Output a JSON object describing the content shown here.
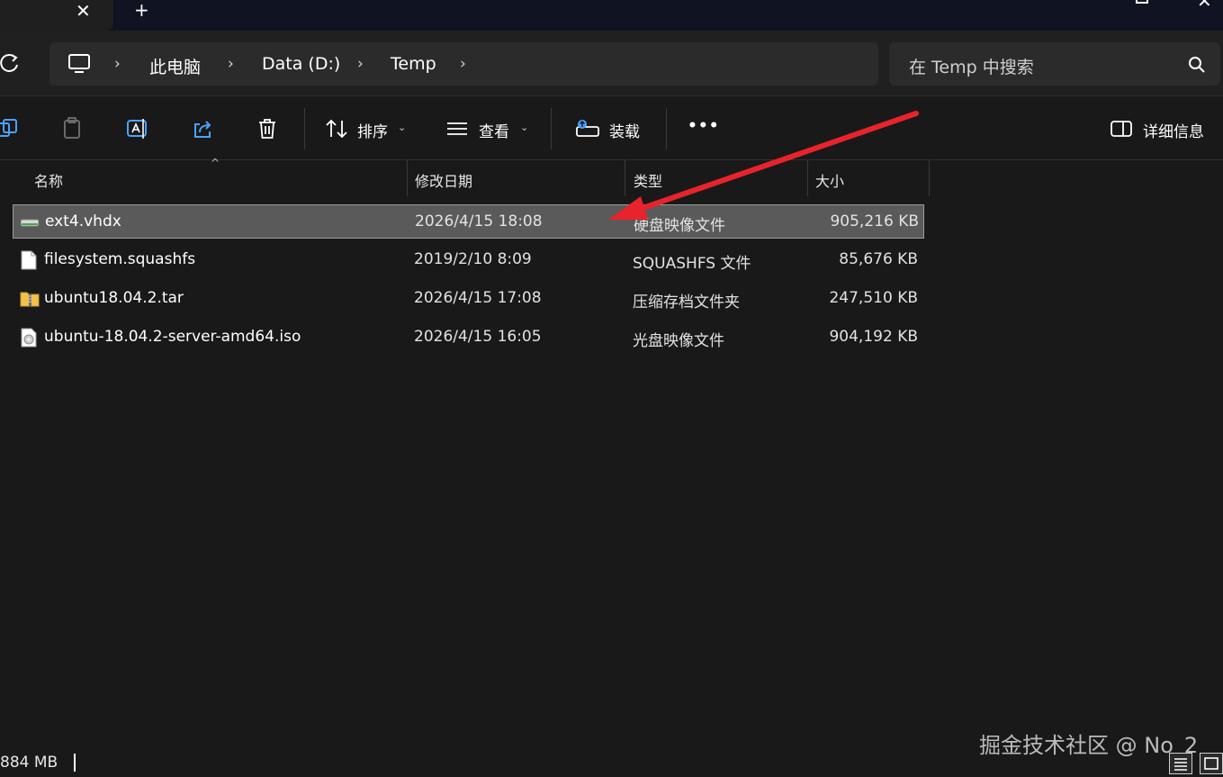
{
  "titlebar": {
    "close_tab_glyph": "✕",
    "new_tab_glyph": "+"
  },
  "breadcrumb": {
    "items": [
      "此电脑",
      "Data (D:)",
      "Temp"
    ],
    "separator": "›"
  },
  "search": {
    "placeholder": "在 Temp 中搜索"
  },
  "toolbar": {
    "sort_label": "排序",
    "view_label": "查看",
    "mount_label": "装载",
    "more_label": "•••",
    "details_label": "详细信息"
  },
  "columns": {
    "name": "名称",
    "date": "修改日期",
    "type": "类型",
    "size": "大小"
  },
  "files": [
    {
      "name": "ext4.vhdx",
      "date": "2026/4/15 18:08",
      "type": "硬盘映像文件",
      "size": "905,216 KB",
      "icon": "drive-icon",
      "selected": true
    },
    {
      "name": "filesystem.squashfs",
      "date": "2019/2/10 8:09",
      "type": "SQUASHFS 文件",
      "size": "85,676 KB",
      "icon": "document-icon",
      "selected": false
    },
    {
      "name": "ubuntu18.04.2.tar",
      "date": "2026/4/15 17:08",
      "type": "压缩存档文件夹",
      "size": "247,510 KB",
      "icon": "zip-folder-icon",
      "selected": false
    },
    {
      "name": "ubuntu-18.04.2-server-amd64.iso",
      "date": "2026/4/15 16:05",
      "type": "光盘映像文件",
      "size": "904,192 KB",
      "icon": "disc-image-icon",
      "selected": false
    }
  ],
  "status": {
    "text": "884 MB"
  },
  "watermark": "掘金技术社区 @ No_2",
  "colors": {
    "background": "#191919",
    "selection": "#5a5a5a",
    "annotation_arrow": "#e8232b",
    "accent_blue": "#4aa3ff"
  }
}
